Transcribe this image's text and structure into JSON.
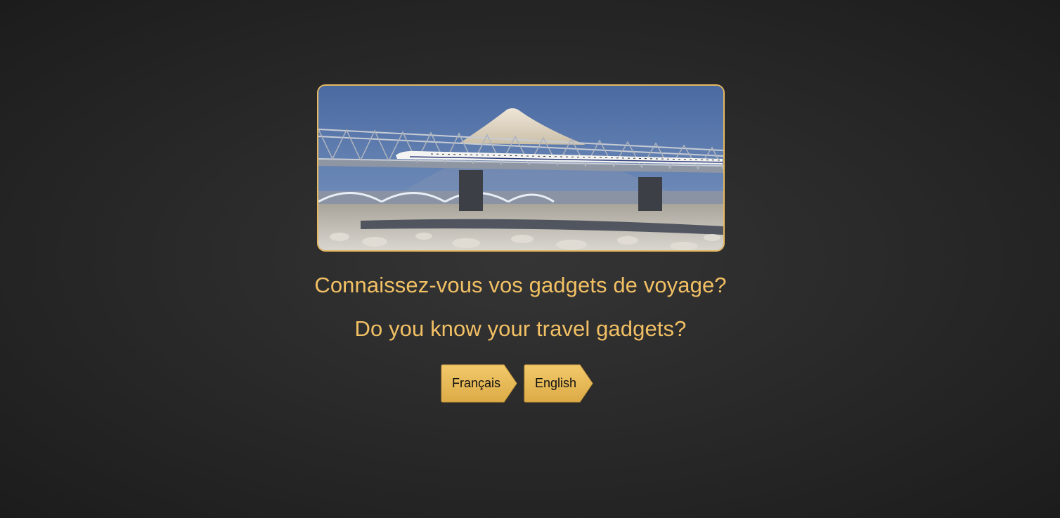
{
  "hero": {
    "image_description": "hero-image"
  },
  "headings": {
    "french": "Connaissez-vous vos gadgets de voyage?",
    "english": "Do you know your travel gadgets?"
  },
  "languages": {
    "french_label": "Français",
    "english_label": "English"
  },
  "colors": {
    "accent": "#f2c064",
    "button": "#e8b85a",
    "background": "#2a2a2a"
  }
}
